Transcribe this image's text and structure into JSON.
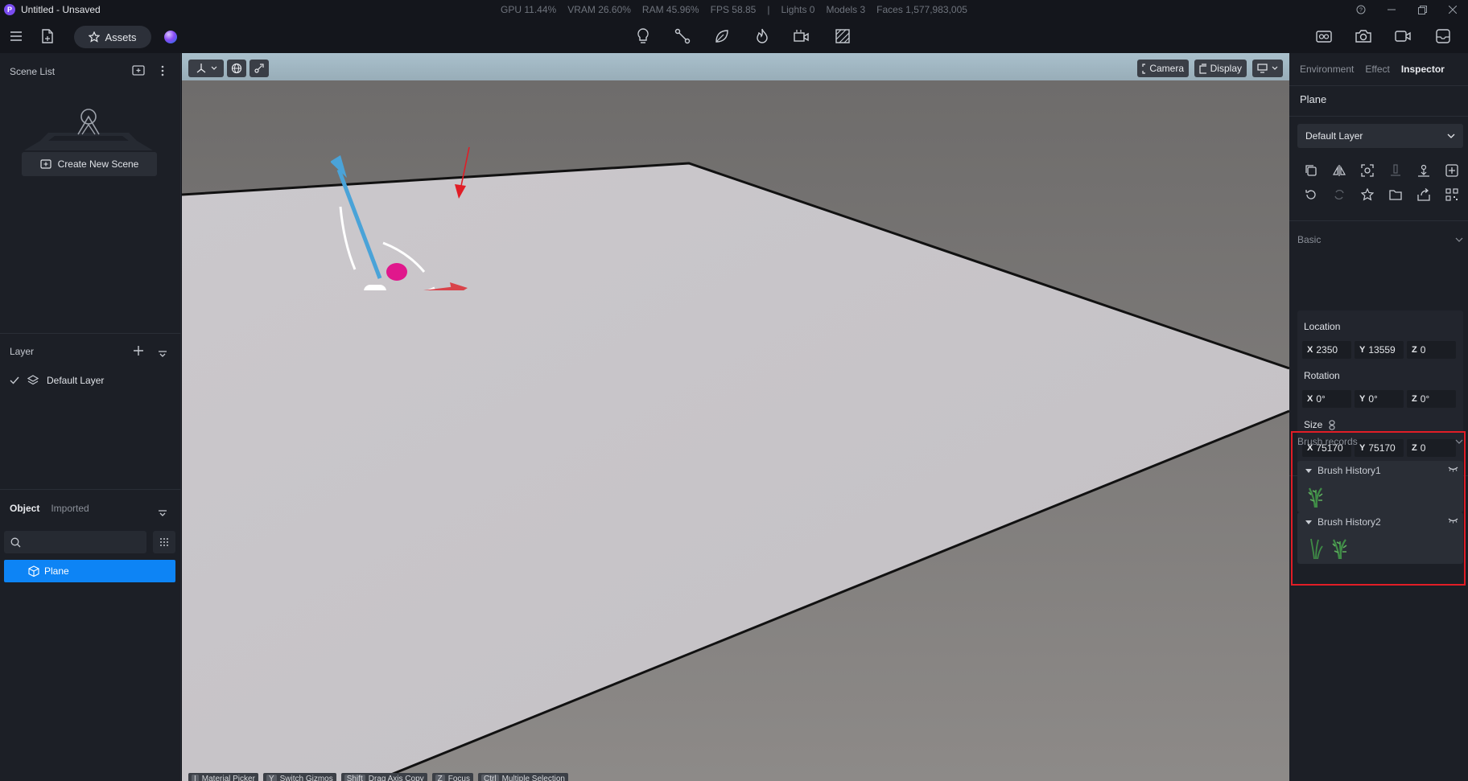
{
  "window": {
    "title": "Untitled - Unsaved",
    "logo_letter": "P",
    "stats": {
      "gpu": "GPU 11.44%",
      "vram": "VRAM 26.60%",
      "ram": "RAM 45.96%",
      "fps": "FPS 58.85",
      "divider": "|",
      "lights": "Lights 0",
      "models": "Models 3",
      "faces": "Faces 1,577,983,005"
    }
  },
  "toolbar": {
    "assets_label": "Assets",
    "center_icons": [
      "light-bulb-icon",
      "path-node-icon",
      "leaf-icon",
      "fire-icon",
      "video-camera-icon",
      "hatch-box-icon"
    ],
    "right_icons": [
      "render-icon",
      "camera-icon",
      "record-video-icon",
      "panel-toggle-icon"
    ]
  },
  "left": {
    "scene_list_title": "Scene List",
    "create_scene_label": "Create New Scene",
    "layer_title": "Layer",
    "layers": [
      {
        "name": "Default Layer",
        "checked": true
      }
    ],
    "object_tabs": {
      "object": "Object",
      "imported": "Imported"
    },
    "search_placeholder": "",
    "objects": [
      {
        "name": "Plane",
        "selected": true
      }
    ]
  },
  "viewport": {
    "camera_label": "Camera",
    "display_label": "Display",
    "hints": [
      {
        "key": "I",
        "label": "Material Picker"
      },
      {
        "key": "Y",
        "label": "Switch Gizmos"
      },
      {
        "key": "Shift",
        "label": "Drag Axis Copy"
      },
      {
        "key": "Z",
        "label": "Focus"
      },
      {
        "key": "Ctrl",
        "label": "Multiple Selection"
      }
    ]
  },
  "inspector": {
    "tabs": {
      "environment": "Environment",
      "effect": "Effect",
      "inspector": "Inspector"
    },
    "object_name": "Plane",
    "layer_value": "Default Layer",
    "basic_title": "Basic",
    "location_label": "Location",
    "location": {
      "x": "2350",
      "y": "13559",
      "z": "0"
    },
    "rotation_label": "Rotation",
    "rotation": {
      "x": "0°",
      "y": "0°",
      "z": "0°"
    },
    "size_label": "Size",
    "size": {
      "x": "75170",
      "y": "75170",
      "z": "0"
    },
    "axis_x": "X",
    "axis_y": "Y",
    "axis_z": "Z",
    "brush_records_title": "Brush records",
    "brush_histories": [
      {
        "name": "Brush History1",
        "items": 1
      },
      {
        "name": "Brush History2",
        "items": 2
      }
    ]
  },
  "colors": {
    "accent": "#0d84f5",
    "highlight_frame": "#e11d26",
    "gizmo_x": "#d9434a",
    "gizmo_y": "#3fa54a",
    "gizmo_z": "#4aa3d8"
  }
}
